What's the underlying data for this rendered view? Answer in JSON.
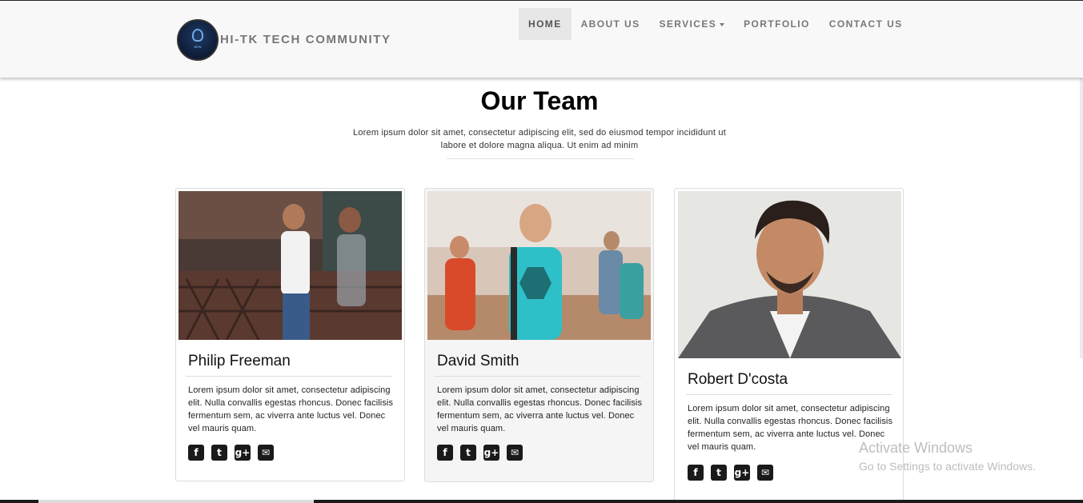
{
  "brand": {
    "name": "HI-TK TECH COMMUNITY",
    "logo_text": "HITK"
  },
  "nav": [
    {
      "label": "HOME",
      "active": true
    },
    {
      "label": "ABOUT US"
    },
    {
      "label": "SERVICES"
    },
    {
      "label": "PORTFOLIO"
    },
    {
      "label": "CONTACT US"
    }
  ],
  "section": {
    "title": "Our Team",
    "subtitle": "Lorem ipsum dolor sit amet, consectetur adipiscing elit, sed do eiusmod tempor incididunt ut labore et dolore magna aliqua. Ut enim ad minim"
  },
  "team": [
    {
      "name": "Philip Freeman",
      "bio": "Lorem ipsum dolor sit amet, consectetur adipiscing elit. Nulla convallis egestas rhoncus. Donec facilisis fermentum sem, ac viverra ante luctus vel. Donec vel mauris quam."
    },
    {
      "name": "David Smith",
      "bio": "Lorem ipsum dolor sit amet, consectetur adipiscing elit. Nulla convallis egestas rhoncus. Donec facilisis fermentum sem, ac viverra ante luctus vel. Donec vel mauris quam."
    },
    {
      "name": "Robert D'costa",
      "bio": "Lorem ipsum dolor sit amet, consectetur adipiscing elit. Nulla convallis egestas rhoncus. Donec facilisis fermentum sem, ac viverra ante luctus vel. Donec vel mauris quam."
    }
  ],
  "social_icons": [
    "facebook-icon",
    "twitter-icon",
    "google-plus-icon",
    "envelope-icon"
  ],
  "windows_watermark": {
    "title": "Activate Windows",
    "subtitle": "Go to Settings to activate Windows."
  },
  "colors": {
    "navbar_bg": "#f8f8f8",
    "nav_text": "#777777",
    "active_bg": "#e7e7e7",
    "icon_bg": "#1a1a1a"
  }
}
